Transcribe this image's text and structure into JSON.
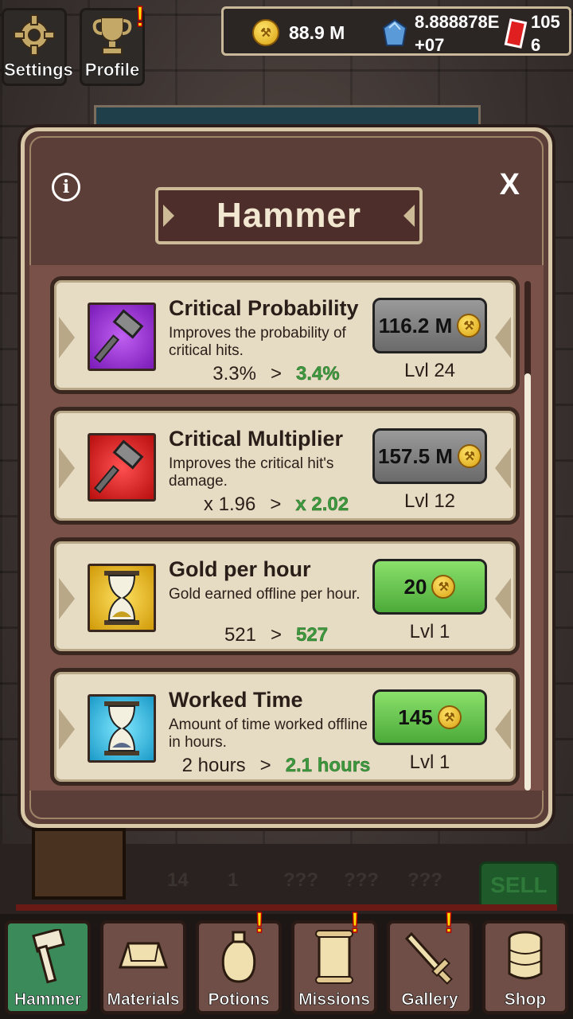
{
  "top": {
    "settings_label": "Settings",
    "profile_label": "Profile",
    "alert_mark": "!"
  },
  "currency": {
    "gold": "88.9 M",
    "gems": "8.888878E+07",
    "tickets": "1056"
  },
  "modal": {
    "info": "i",
    "close": "X",
    "title": "Hammer"
  },
  "upgrades": [
    {
      "name": "Critical Probability",
      "description": "Improves the probability of critical hits.",
      "current": "3.3%",
      "arrow": ">",
      "next": "3.4%",
      "cost": "116.2 M",
      "level": "Lvl 24",
      "buy_state": "disabled",
      "icon": "hammer-icon",
      "color": "#8a2ad0"
    },
    {
      "name": "Critical Multiplier",
      "description": "Improves the critical hit's damage.",
      "current": "x 1.96",
      "arrow": ">",
      "next": "x 2.02",
      "cost": "157.5 M",
      "level": "Lvl 12",
      "buy_state": "disabled",
      "icon": "hammer-icon",
      "color": "#d81a1a"
    },
    {
      "name": "Gold per hour",
      "description": "Gold earned offline per hour.",
      "current": "521",
      "arrow": ">",
      "next": "527",
      "cost": "20",
      "level": "Lvl 1",
      "buy_state": "enabled",
      "icon": "hourglass-icon",
      "color": "#e8b010"
    },
    {
      "name": "Worked Time",
      "description": "Amount of time worked offline in hours.",
      "current": "2 hours",
      "arrow": ">",
      "next": "2.1 hours",
      "cost": "145",
      "level": "Lvl 1",
      "buy_state": "enabled",
      "icon": "hourglass-icon",
      "color": "#20b0d8"
    }
  ],
  "forge": {
    "stock": [
      "14",
      "1",
      "???",
      "???",
      "???"
    ],
    "sell": "SELL"
  },
  "nav": {
    "items": [
      "Hammer",
      "Materials",
      "Potions",
      "Missions",
      "Gallery",
      "Shop"
    ],
    "active": "Hammer"
  }
}
